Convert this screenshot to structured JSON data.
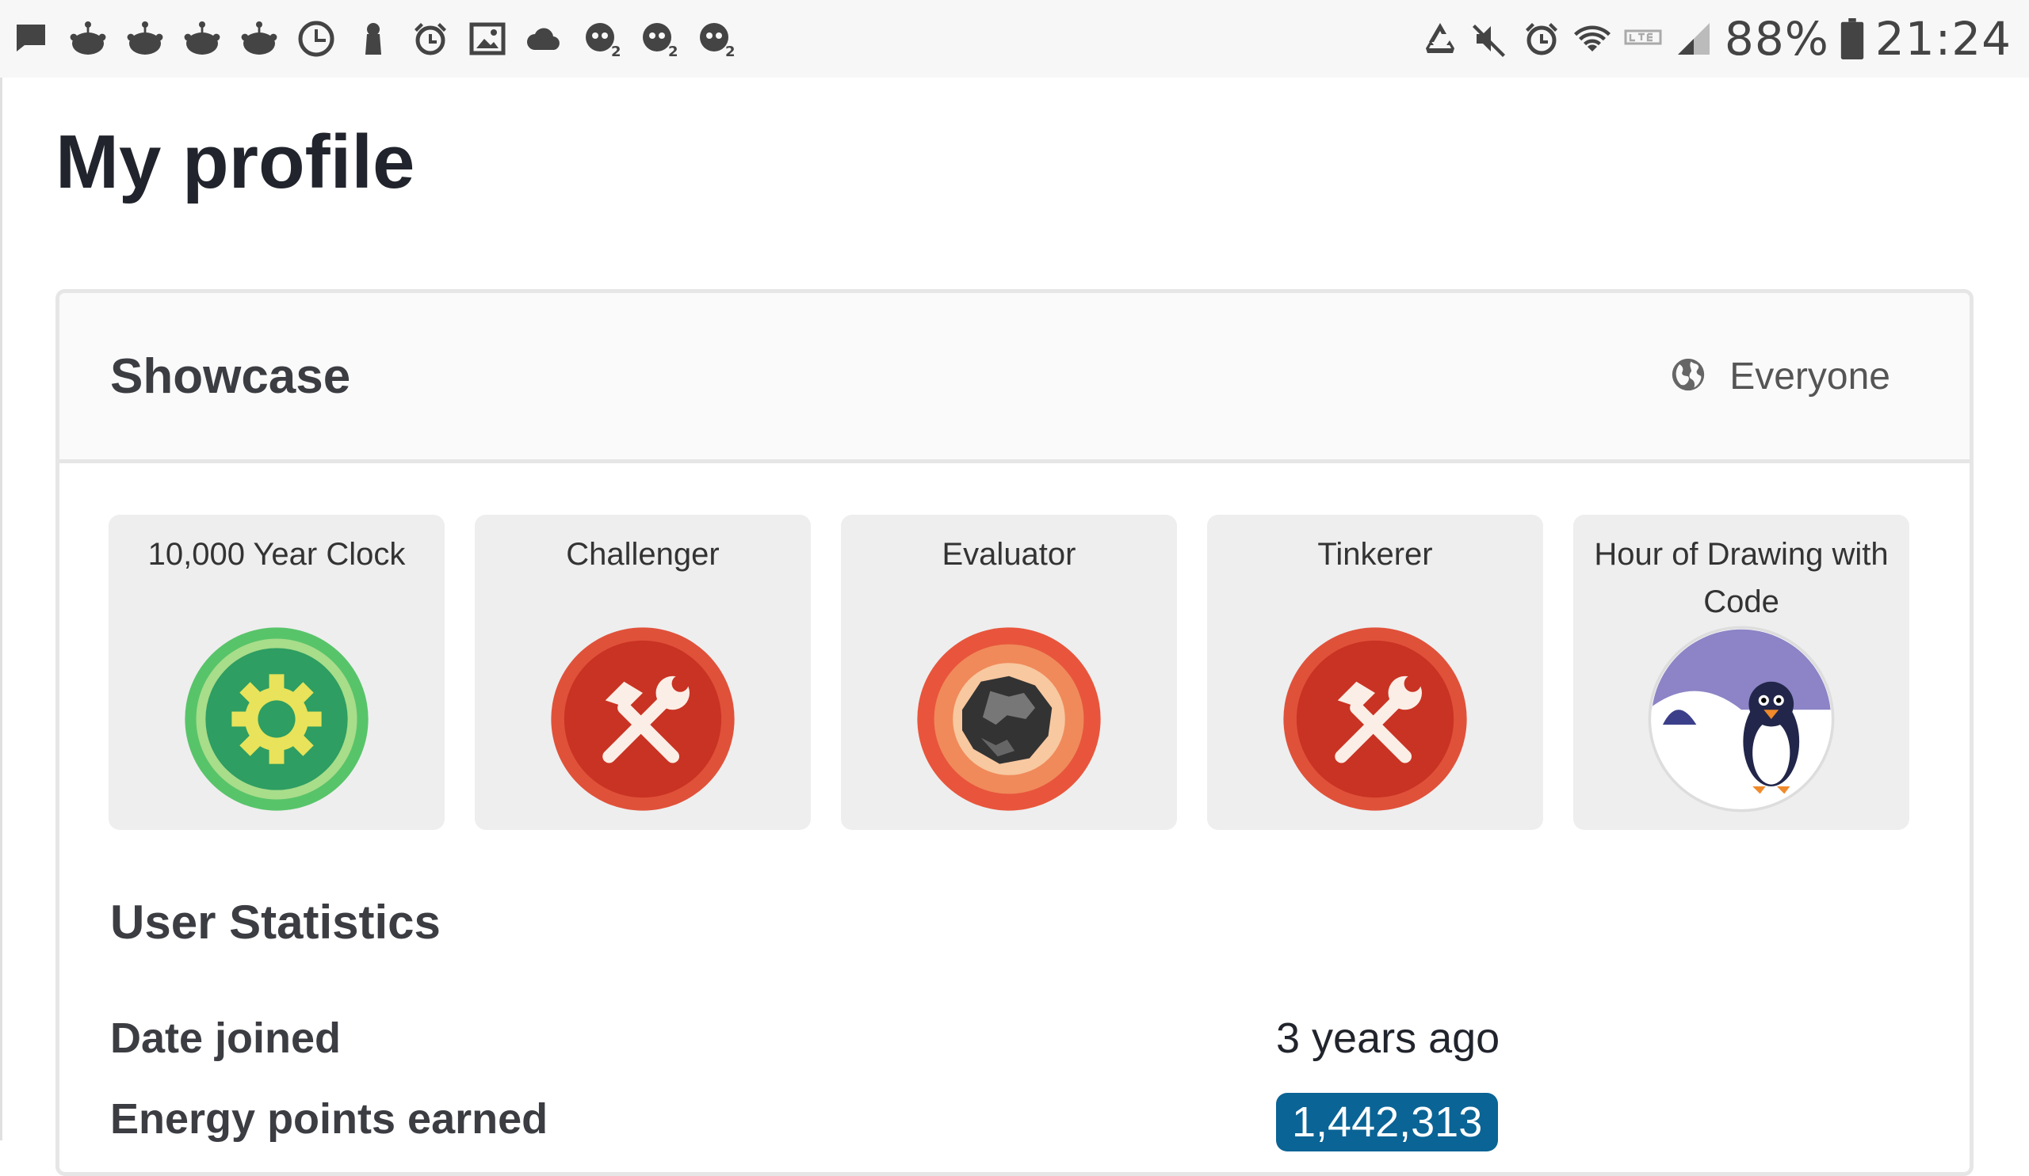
{
  "status_bar": {
    "left_icons": [
      "message-icon",
      "reddit-icon",
      "reddit-icon",
      "reddit-icon",
      "reddit-icon",
      "clock-icon",
      "keyhole-icon",
      "alarm-icon",
      "image-icon",
      "cloud-icon",
      "game-icon",
      "game-icon",
      "game-icon"
    ],
    "right_icons": [
      "recycle-icon",
      "mute-icon",
      "alarm-icon",
      "wifi-icon",
      "lte-icon",
      "signal-icon"
    ],
    "battery_percent": "88%",
    "time": "21:24"
  },
  "page": {
    "title": "My profile"
  },
  "showcase": {
    "title": "Showcase",
    "visibility_label": "Everyone",
    "visibility_icon": "globe-icon",
    "badges": [
      {
        "name": "10,000 Year Clock",
        "icon": "gear-badge-icon",
        "color": "#2e9e62"
      },
      {
        "name": "Challenger",
        "icon": "tools-badge-icon",
        "color": "#d4422b"
      },
      {
        "name": "Evaluator",
        "icon": "meteorite-badge-icon",
        "color": "#d4422b"
      },
      {
        "name": "Tinkerer",
        "icon": "tools-badge-icon",
        "color": "#d4422b"
      },
      {
        "name": "Hour of Drawing with Code",
        "icon": "penguin-badge-icon",
        "color": "#8c84c6"
      }
    ]
  },
  "stats": {
    "title": "User Statistics",
    "date_joined_label": "Date joined",
    "date_joined_value": "3 years ago",
    "energy_label": "Energy points earned",
    "energy_value": "1,442,313",
    "energy_color": "#0a6496"
  }
}
